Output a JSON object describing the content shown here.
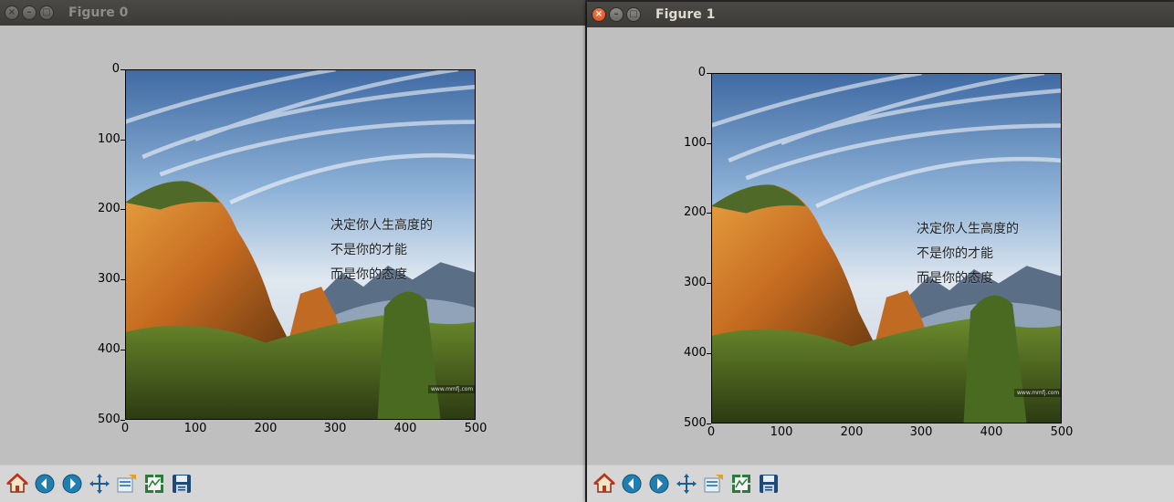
{
  "windows": [
    {
      "title": "Figure 0",
      "active": false,
      "image_text": [
        "决定你人生高度的",
        "不是你的才能",
        "而是你的态度"
      ],
      "watermark": "www.mmfj.com"
    },
    {
      "title": "Figure 1",
      "active": true,
      "image_text": [
        "决定你人生高度的",
        "不是你的才能",
        "而是你的态度"
      ],
      "watermark": "www.mmfj.com"
    }
  ],
  "axes": {
    "x_ticks": [
      "0",
      "100",
      "200",
      "300",
      "400",
      "500"
    ],
    "y_ticks": [
      "0",
      "100",
      "200",
      "300",
      "400",
      "500"
    ],
    "xlim": [
      0,
      500
    ],
    "ylim": [
      500,
      0
    ]
  },
  "toolbar": [
    {
      "name": "home-icon"
    },
    {
      "name": "back-icon"
    },
    {
      "name": "forward-icon"
    },
    {
      "name": "pan-icon"
    },
    {
      "name": "zoom-icon"
    },
    {
      "name": "configure-subplots-icon"
    },
    {
      "name": "save-icon"
    }
  ],
  "colors": {
    "titlebar": "#3c3b37",
    "figure_bg": "#bfbfbf",
    "toolbar_bg": "#d6d6d6",
    "close_button": "#e95420"
  }
}
